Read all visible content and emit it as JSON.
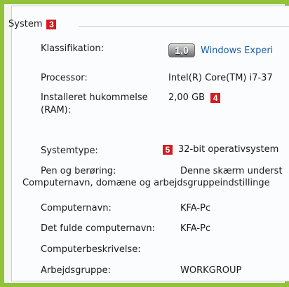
{
  "system": {
    "title": "System",
    "marker": "3",
    "rows": {
      "classification": {
        "label": "Klassifikation:",
        "badge": "1,0",
        "link": "Windows Experi"
      },
      "processor": {
        "label": "Processor:",
        "value": "Intel(R) Core(TM) i7-37"
      },
      "memory": {
        "label_line1": "Installeret hukommelse",
        "label_line2": "(RAM):",
        "value": "2,00 GB",
        "marker": "4"
      },
      "systemtype": {
        "label": "Systemtype:",
        "value": "32-bit operativsystem",
        "marker": "5"
      },
      "pen": {
        "label": "Pen og berøring:",
        "value": "Denne skærm underst"
      }
    }
  },
  "computer": {
    "title": "Computernavn, domæne og arbejdsgruppeindstillinge",
    "rows": {
      "name": {
        "label": "Computernavn:",
        "value": "KFA-Pc"
      },
      "fullname": {
        "label": "Det fulde computernavn:",
        "value": "KFA-Pc"
      },
      "description": {
        "label": "Computerbeskrivelse:",
        "value": ""
      },
      "workgroup": {
        "label": "Arbejdsgruppe:",
        "value": "WORKGROUP"
      }
    }
  },
  "colors": {
    "frame": "#92c23a",
    "marker": "#d71920",
    "link": "#1a5ea9"
  }
}
